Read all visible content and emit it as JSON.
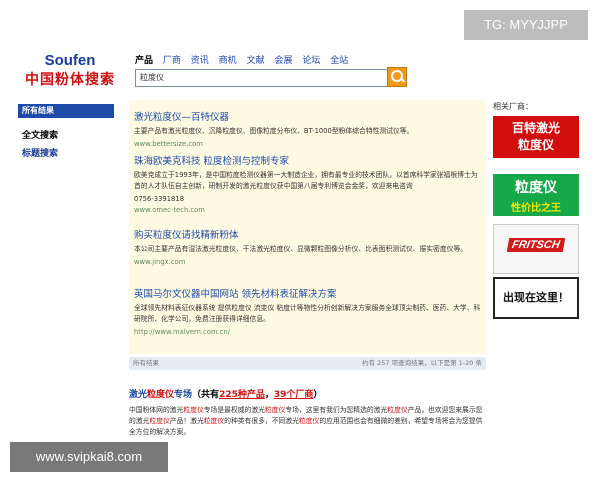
{
  "watermark_top": "TG: MYYJJPP",
  "watermark_bottom": "www.svipkai8.com",
  "logo": {
    "line1": "Soufen",
    "line2": "中国粉体搜索"
  },
  "nav": [
    "产品",
    "厂商",
    "资讯",
    "商机",
    "文献",
    "会展",
    "论坛",
    "全站"
  ],
  "search": {
    "value": "粒度仪"
  },
  "leftbar": {
    "title": "所有结果",
    "links": [
      "全文搜索",
      "标题搜索"
    ]
  },
  "results": [
    {
      "title": "激光粒度仪—百特仪器",
      "desc": "主要产品有激光粒度仪、沉降粒度仪、图像粒度分布仪、BT-1000型粉体综合特性测试仪等。",
      "url": "www.bettersize.com"
    },
    {
      "title": "珠海欧美克科技  粒度检测与控制专家",
      "desc": "欧美克成立于1993年，是中国粒度检测仪器第一大制造企业，拥有最专业的技术团队，以首席科学家张福根博士为首的人才队伍自主创新，研制开发的激光粒度仪获中国第八届专利博览会金奖，欢迎来电咨询",
      "phone": "0756-3391818",
      "url": "www.omec-tech.com"
    },
    {
      "title": "购买粒度仪请找精新粉体",
      "desc": "本公司主要产品有湿法激光粒度仪、干法激光粒度仪、显微颗粒图像分析仪、比表面积测试仪、振实密度仪等。",
      "url": "www.jingx.com"
    },
    {
      "title": "英国马尔文仪器中国网站  领先材料表征解决方案",
      "desc": "全球领先材料表征仪器系统  提供粒度仪  流变仪  粘度计等物性分析创新解决方案服务全球顶尖制药、医药、大学、科研院所、化学公司，免费注册获得详细信息。",
      "url": "http://www.malvern.com.cn/"
    }
  ],
  "results_footer": {
    "left": "所有结果",
    "right": "约有 257 项查询结果，以下是第 1-20 条"
  },
  "ads": {
    "label": "相关厂商：",
    "ad1": [
      "百特激光",
      "粒度仪"
    ],
    "ad2": [
      "粒度仪",
      "性价比之王"
    ],
    "ad3": "FRITSCH",
    "ad4": "出现在这里！"
  },
  "bottom": {
    "title_part1": "激光",
    "title_part2": "粒度仪",
    "title_part3": "专场",
    "count_prefix": "（共有",
    "product_count": "225种产品",
    "sep": "，",
    "vendor_count": "39个厂商",
    "count_suffix": "）",
    "p1": "中国粉体网的激光",
    "hl1": "粒度仪",
    "p2": "专场是最权威的激光",
    "hl2": "粒度仪",
    "p3": "专场，这里有我们为您精选的激光",
    "hl3": "粒度仪",
    "p4": "产品，也欢迎您来展示您的激光",
    "hl4": "粒度仪",
    "p5": "产品！激光",
    "hl5": "粒度仪",
    "p6": "的种类有很多，不同激光",
    "hl6": "粒度仪",
    "p7": "的应用范围也会有细微的差别，希望专场将会为您提供全方位的解决方案。"
  },
  "colors": {
    "link": "#1e4aa8",
    "brand_red": "#d01010",
    "results_bg": "#fffbe3",
    "search_button": "#f09a1a"
  }
}
